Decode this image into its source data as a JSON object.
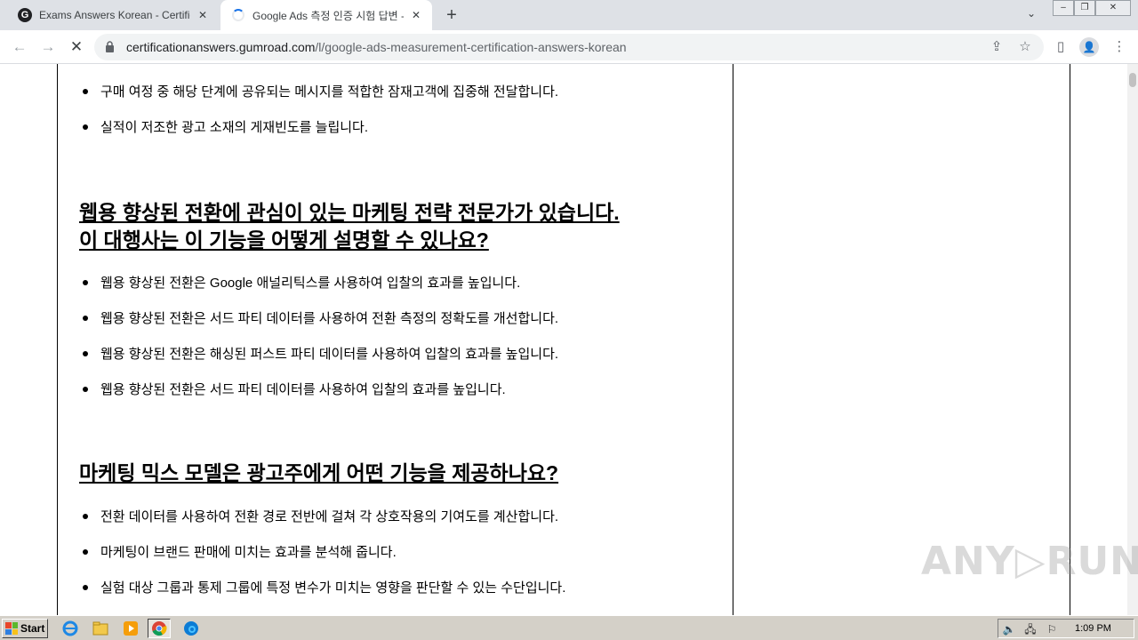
{
  "tabs": [
    {
      "title": "Exams Answers Korean - Certifica",
      "favicon": "G",
      "active": false
    },
    {
      "title": "Google Ads 측정 인증 시험 답변 - Ko",
      "active": true
    }
  ],
  "window_controls": {
    "minimize": "‒",
    "restore": "❐",
    "close": "✕"
  },
  "toolbar": {
    "url_host": "certificationanswers.gumroad.com",
    "url_path": "/l/google-ads-measurement-certification-answers-korean"
  },
  "content": {
    "top_bullets": [
      "구매 여정 중 해당 단계에 공유되는 메시지를 적합한 잠재고객에 집중해 전달합니다.",
      "실적이 저조한 광고 소재의 게재빈도를 늘립니다."
    ],
    "q1": {
      "line1": "웹용 향상된 전환에 관심이 있는 마케팅 전략 전문가가 있습니다.",
      "line2": "이 대행사는 이 기능을 어떻게 설명할 수 있나요?",
      "answers": [
        "웹용 향상된 전환은 Google 애널리틱스를 사용하여 입찰의 효과를 높입니다.",
        "웹용 향상된 전환은 서드 파티 데이터를 사용하여 전환 측정의 정확도를 개선합니다.",
        "웹용 향상된 전환은 해싱된 퍼스트 파티 데이터를 사용하여 입찰의 효과를 높입니다.",
        "웹용 향상된 전환은 서드 파티 데이터를 사용하여 입찰의 효과를 높입니다."
      ]
    },
    "q2": {
      "title": "마케팅 믹스 모델은 광고주에게 어떤 기능을 제공하나요?",
      "answers": [
        "전환 데이터를 사용하여 전환 경로 전반에 걸쳐 각 상호작용의 기여도를 계산합니다.",
        "마케팅이 브랜드 판매에 미치는 효과를 분석해 줍니다.",
        "실험 대상 그룹과 통제 그룹에 특정 변수가 미치는 영향을 판단할 수 있는 수단입니다."
      ]
    }
  },
  "watermark": "ANY▷RUN",
  "taskbar": {
    "start_label": "Start",
    "clock": "1:09 PM"
  },
  "colors": {
    "tabstrip": "#dee1e6",
    "accent": "#1a73e8",
    "taskbar": "#d4d0c8"
  }
}
